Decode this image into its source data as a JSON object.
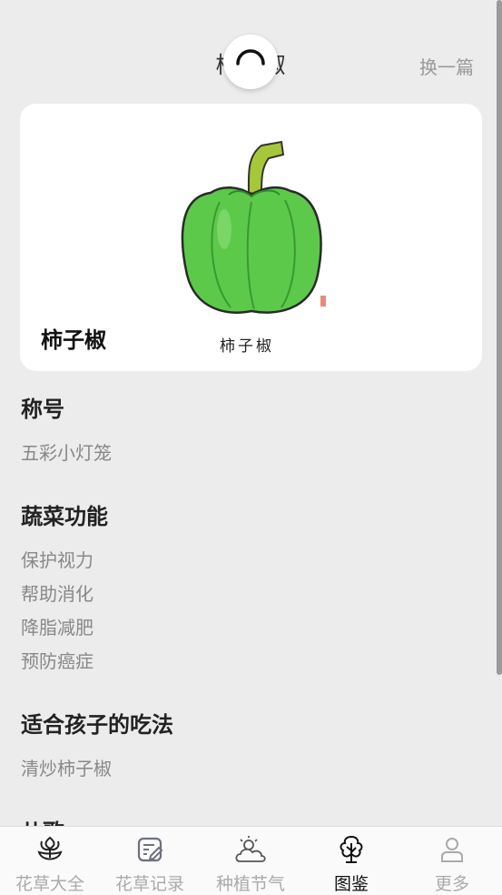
{
  "header": {
    "title": "柿子椒",
    "switch_label": "换一篇"
  },
  "card": {
    "name": "柿子椒",
    "image_caption": "柿子椒",
    "pepper_color": "#5cc94a"
  },
  "sections": [
    {
      "title": "称号",
      "items": [
        "五彩小灯笼"
      ]
    },
    {
      "title": "蔬菜功能",
      "items": [
        "保护视力",
        "帮助消化",
        "降脂减肥",
        "预防癌症"
      ]
    },
    {
      "title": "适合孩子的吃法",
      "items": [
        "清炒柿子椒"
      ]
    },
    {
      "title": "儿歌",
      "items": []
    }
  ],
  "tabs": [
    {
      "label": "花草大全",
      "icon": "flower-icon",
      "active": false
    },
    {
      "label": "花草记录",
      "icon": "edit-note-icon",
      "active": false
    },
    {
      "label": "种植节气",
      "icon": "weather-icon",
      "active": false
    },
    {
      "label": "图鉴",
      "icon": "tree-icon",
      "active": true
    },
    {
      "label": "更多",
      "icon": "person-icon",
      "active": false
    }
  ],
  "colors": {
    "background": "#ececec",
    "active_tab": "#111111",
    "inactive_tab": "#aaaaaa"
  }
}
